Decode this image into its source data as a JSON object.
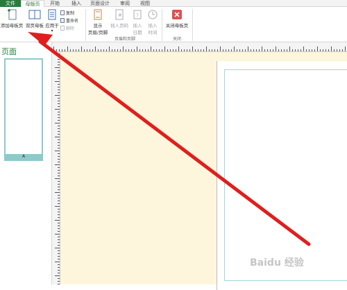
{
  "tabs": [
    {
      "label": "文件"
    },
    {
      "label": "母版页"
    },
    {
      "label": "开始"
    },
    {
      "label": "插入"
    },
    {
      "label": "页面设计"
    },
    {
      "label": "审阅"
    },
    {
      "label": "视图"
    }
  ],
  "ribbon": {
    "add_master": "添加母板页",
    "two_page_master": "双页母板",
    "apply_to": "应用于",
    "copy": "复制",
    "rename": "重命名",
    "delete": "删除",
    "show_header_footer_line1": "显示",
    "show_header_footer_line2": "页眉/页脚",
    "insert_page_num_line1": "插入页码",
    "insert_date_line1": "插入",
    "insert_date_line2": "日期",
    "insert_time_line1": "插入",
    "insert_time_line2": "时间",
    "close_master": "关闭母板页",
    "group_master": "母版",
    "group_header_footer": "页眉和页脚",
    "group_close": "关闭"
  },
  "left_pane": {
    "title": "页面",
    "thumb_label": "A"
  },
  "watermark": "Baidu 经验",
  "colors": {
    "accent": "#2b7a3d",
    "canvas": "#fdf6dc",
    "arrow": "#e01e1e"
  }
}
